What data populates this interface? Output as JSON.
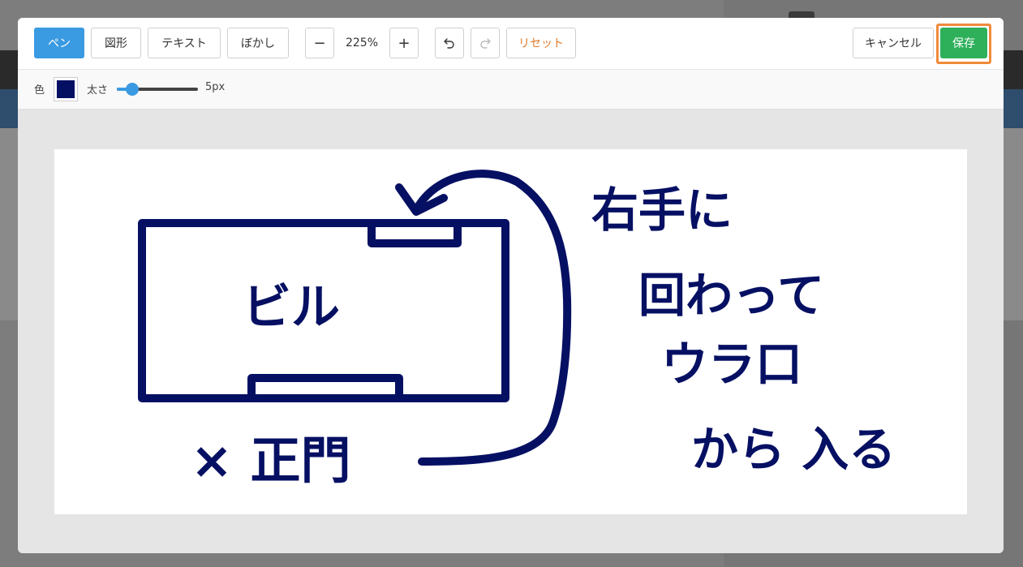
{
  "toolbar": {
    "tools": [
      "ペン",
      "図形",
      "テキスト",
      "ぼかし"
    ],
    "active_tool": "ペン",
    "zoom_out_label": "−",
    "zoom_level": "225%",
    "zoom_in_label": "+",
    "undo_icon": "undo-icon",
    "redo_icon": "redo-icon",
    "reset_label": "リセット",
    "cancel_label": "キャンセル",
    "save_label": "保存"
  },
  "options": {
    "color_label": "色",
    "color_value": "#061063",
    "thickness_label": "太さ",
    "thickness_value": "5px",
    "thickness_fraction": 0.19
  },
  "colors": {
    "accent": "#3a9ae2",
    "save": "#2eb05b",
    "reset": "#e07b2a",
    "highlight": "#f08a3a",
    "ink": "#061063"
  },
  "drawing": {
    "building_label": "ビル",
    "gate_label": "× 正門",
    "instruction_lines": [
      "右手に",
      "回わって",
      "ウラ口",
      "から 入る"
    ]
  }
}
